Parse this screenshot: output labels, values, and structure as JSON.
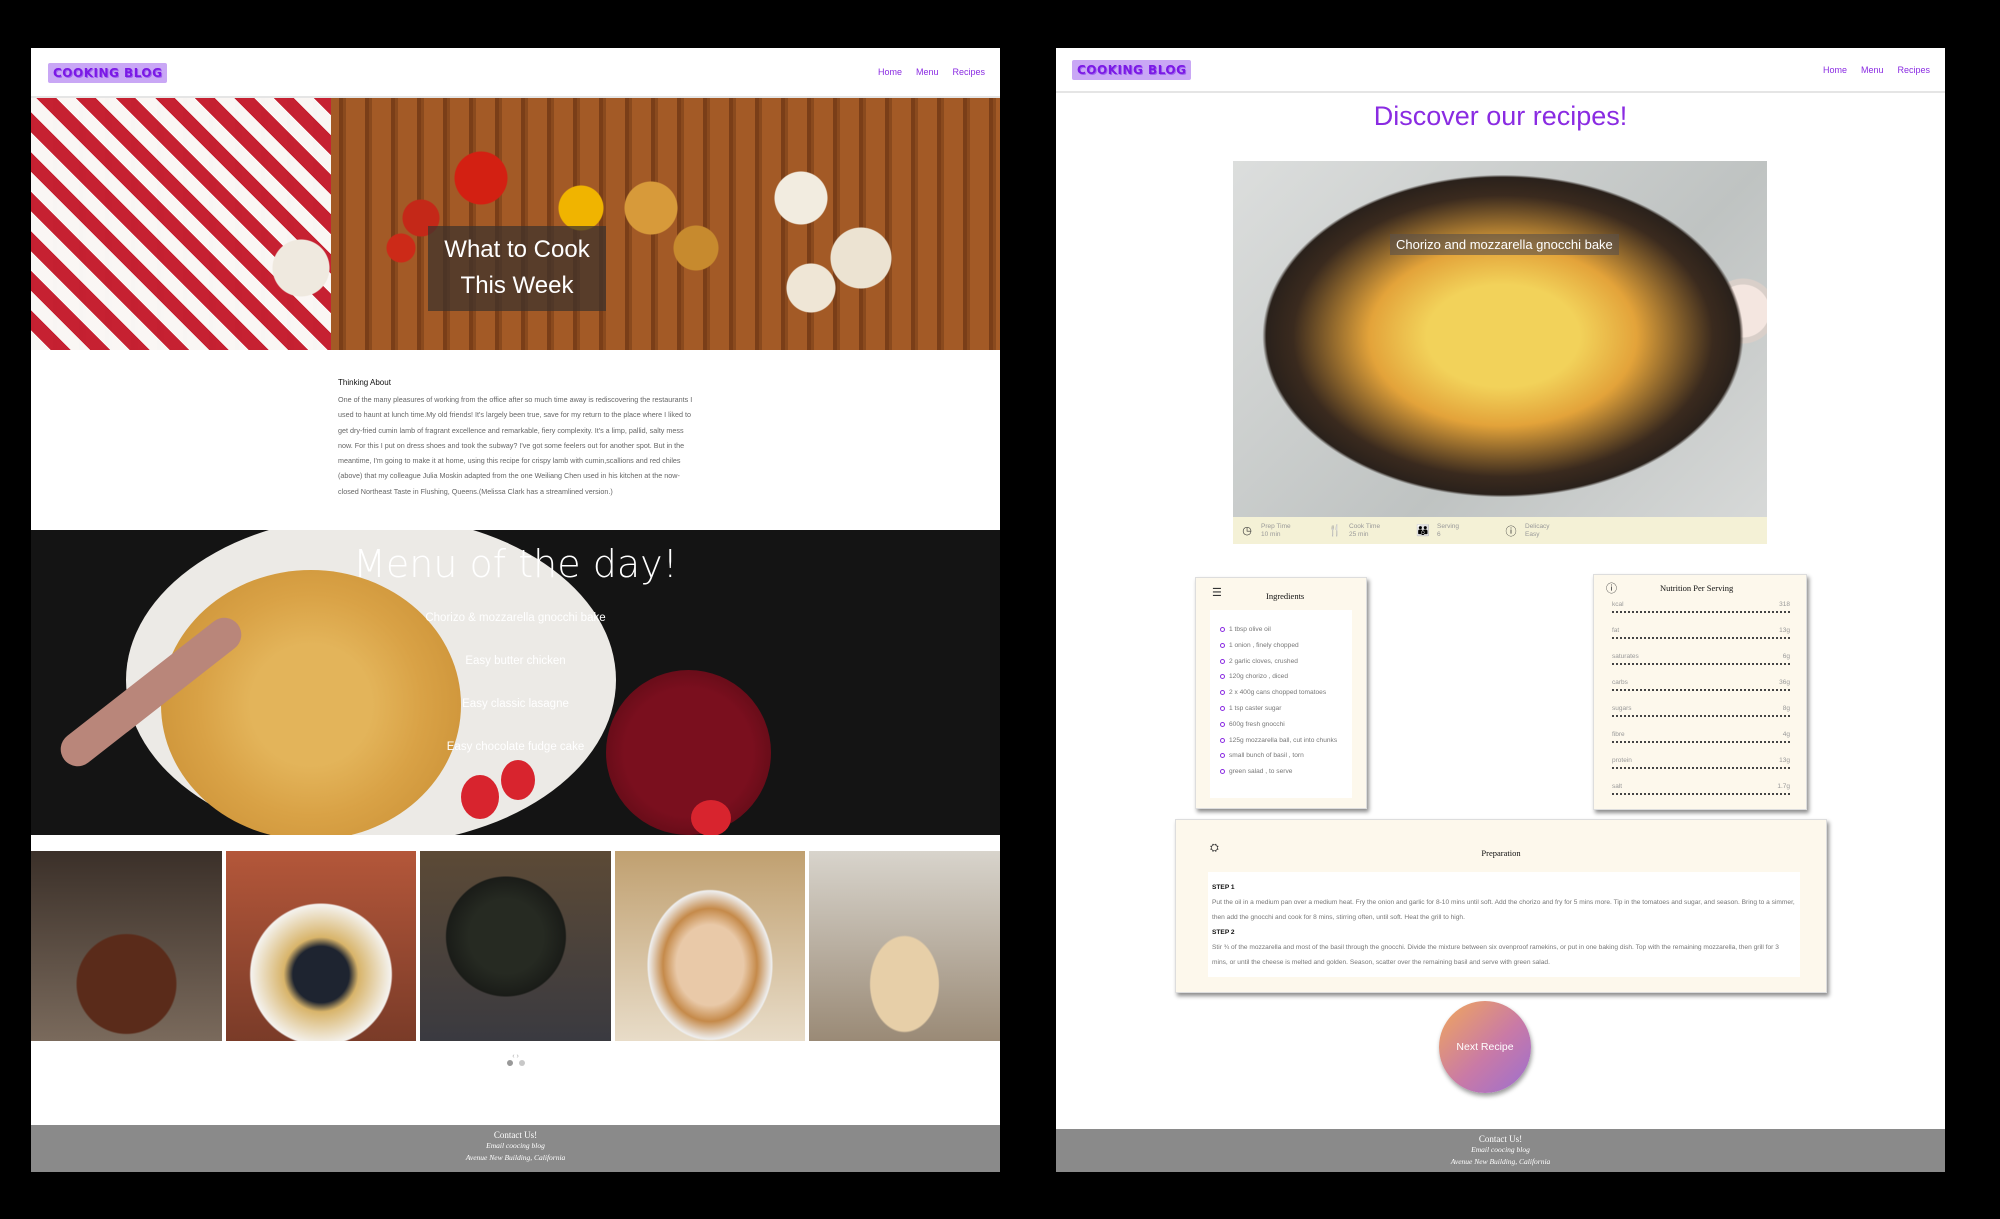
{
  "brand": {
    "logo": "COOKING BLOG",
    "accent": "#8a2be2"
  },
  "nav": {
    "items": [
      "Home",
      "Menu",
      "Recipes"
    ]
  },
  "home": {
    "hero_title": "What to Cook This Week",
    "article": {
      "heading": "Thinking About",
      "body": "One of the many pleasures of working from the office after so much time away is rediscovering the restaurants I used to haunt at lunch time.My old friends! It's largely been true, save for my return to the place where I liked to get dry-fried cumin lamb of fragrant excellence and remarkable, fiery complexity. It's a limp, pallid, salty mess now. For this I put on dress shoes and took the subway? I've got some feelers out for another spot. But in the meantime, I'm going to make it at home, using this recipe for crispy lamb with cumin,scallions and red chiles (above) that my colleague Julia Moskin adapted from the one Weiliang Chen used in his kitchen at the now-closed Northeast Taste in Flushing, Queens.(Melissa Clark has a streamlined version.)"
    },
    "menu_title": "Menu of the day!",
    "menu_items": [
      "Chorizo & mozzarella gnocchi bake",
      "Easy butter chicken",
      "Easy classic lasagne",
      "Easy chocolate fudge cake"
    ],
    "carousel_arrows": "‹ ›"
  },
  "recipe": {
    "page_title": "Discover our recipes!",
    "name": "Chorizo and mozzarella gnocchi bake",
    "stats": [
      {
        "icon": "clock-icon",
        "label": "Prep Time",
        "value": "10 min"
      },
      {
        "icon": "cutlery-icon",
        "label": "Cook Time",
        "value": "25 min"
      },
      {
        "icon": "people-icon",
        "label": "Serving",
        "value": "6"
      },
      {
        "icon": "info-icon",
        "label": "Delicacy",
        "value": "Easy"
      }
    ],
    "ingredients_title": "Ingredients",
    "ingredients": [
      "1 tbsp olive oil",
      "1 onion , finely chopped",
      "2 garlic cloves, crushed",
      "120g chorizo , diced",
      "2 x 400g cans chopped tomatoes",
      "1 tsp caster sugar",
      "600g fresh gnocchi",
      "125g mozzarella ball, cut into chunks",
      "small bunch of basil , torn",
      "green salad , to serve"
    ],
    "nutrition_title": "Nutrition Per Serving",
    "nutrition": [
      {
        "label": "kcal",
        "value": "318"
      },
      {
        "label": "fat",
        "value": "13g"
      },
      {
        "label": "saturates",
        "value": "6g"
      },
      {
        "label": "carbs",
        "value": "36g"
      },
      {
        "label": "sugars",
        "value": "8g"
      },
      {
        "label": "fibre",
        "value": "4g"
      },
      {
        "label": "protein",
        "value": "13g"
      },
      {
        "label": "salt",
        "value": "1.7g"
      }
    ],
    "preparation_title": "Preparation",
    "steps": [
      {
        "label": "STEP 1",
        "text": "Put the oil in a medium pan over a medium heat. Fry the onion and garlic for 8-10 mins until soft. Add the chorizo and fry for 5 mins more. Tip in the tomatoes and sugar, and season. Bring to a simmer, then add the gnocchi and cook for 8 mins, stirring often, until soft. Heat the grill to high."
      },
      {
        "label": "STEP 2",
        "text": "Stir ¾ of the mozzarella and most of the basil through the gnocchi. Divide the mixture between six ovenproof ramekins, or put in one baking dish. Top with the remaining mozzarella, then grill for 3 mins, or until the cheese is melted and golden. Season, scatter over the remaining basil and serve with green salad."
      }
    ],
    "next_button": "Next Recipe"
  },
  "footer": {
    "title": "Contact Us!",
    "email": "Email coocing blog",
    "address": "Avenue New Building, California"
  }
}
